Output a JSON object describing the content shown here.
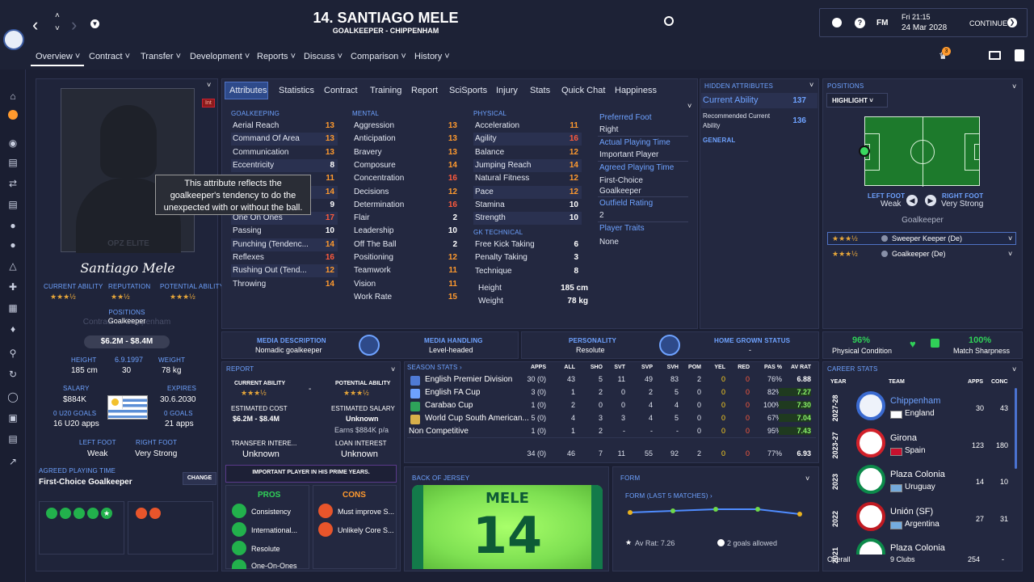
{
  "header": {
    "title": "14. SANTIAGO MELE",
    "subtitle": "GOALKEEPER - CHIPPENHAM",
    "date_line1": "Fri 21:15",
    "date_line2": "24 Mar 2028",
    "continue_label": "CONTINUE",
    "fm_label": "FM",
    "notif_count": "3"
  },
  "nav": [
    "Overview",
    "Contract",
    "Transfer",
    "Development",
    "Reports",
    "Discuss",
    "Comparison",
    "History"
  ],
  "tabs": [
    "Attributes",
    "Statistics",
    "Contract",
    "Training",
    "Report",
    "SciSports",
    "Injury",
    "Stats",
    "Quick Chat",
    "Happiness"
  ],
  "profile": {
    "int_badge": "Int",
    "photo_watermark": "OPZ ELITE",
    "signature": "Santiago Mele",
    "current_ability_label": "CURRENT ABILITY",
    "reputation_label": "REPUTATION",
    "potential_ability_label": "POTENTIAL ABILITY",
    "current_stars": "★★★½",
    "reputation_stars": "★★½",
    "potential_stars": "★★★½",
    "positions_label": "POSITIONS",
    "position_value": "Goalkeeper",
    "position_ghost": "Contract ... Chippenham",
    "value": "$6.2M - $8.4M",
    "height_label": "HEIGHT",
    "height": "185 cm",
    "dob": "6.9.1997",
    "age": "30",
    "weight_label": "WEIGHT",
    "weight": "78 kg",
    "salary_label": "SALARY",
    "salary": "$884K",
    "expires_label": "EXPIRES",
    "expires": "30.6.2030",
    "u20_goals": "0 U20 GOALS",
    "u20_apps": "16 U20 apps",
    "goals": "0 GOALS",
    "apps": "21 apps",
    "left_foot_label": "LEFT FOOT",
    "left_foot": "Weak",
    "right_foot_label": "RIGHT FOOT",
    "right_foot": "Very Strong",
    "agreed_label": "AGREED PLAYING TIME",
    "agreed_value": "First-Choice Goalkeeper",
    "change_label": "CHANGE"
  },
  "attributes": {
    "goalkeeping_label": "GOALKEEPING",
    "goalkeeping": [
      {
        "name": "Aerial Reach",
        "value": "13"
      },
      {
        "name": "Command Of Area",
        "value": "13"
      },
      {
        "name": "Communication",
        "value": "13"
      },
      {
        "name": "Eccentricity",
        "value": "8"
      },
      {
        "name": "",
        "value": "11"
      },
      {
        "name": "",
        "value": "14"
      },
      {
        "name": "",
        "value": "9"
      },
      {
        "name": "One On Ones",
        "value": "17"
      },
      {
        "name": "Passing",
        "value": "10"
      },
      {
        "name": "Punching (Tendenc...",
        "value": "14"
      },
      {
        "name": "Reflexes",
        "value": "16"
      },
      {
        "name": "Rushing Out (Tend...",
        "value": "12"
      },
      {
        "name": "Throwing",
        "value": "14"
      }
    ],
    "mental_label": "MENTAL",
    "mental": [
      {
        "name": "Aggression",
        "value": "13"
      },
      {
        "name": "Anticipation",
        "value": "13"
      },
      {
        "name": "Bravery",
        "value": "13"
      },
      {
        "name": "Composure",
        "value": "14"
      },
      {
        "name": "Concentration",
        "value": "16"
      },
      {
        "name": "Decisions",
        "value": "12"
      },
      {
        "name": "Determination",
        "value": "16"
      },
      {
        "name": "Flair",
        "value": "2"
      },
      {
        "name": "Leadership",
        "value": "10"
      },
      {
        "name": "Off The Ball",
        "value": "2"
      },
      {
        "name": "Positioning",
        "value": "12"
      },
      {
        "name": "Teamwork",
        "value": "11"
      },
      {
        "name": "Vision",
        "value": "11"
      },
      {
        "name": "Work Rate",
        "value": "15"
      }
    ],
    "physical_label": "PHYSICAL",
    "physical": [
      {
        "name": "Acceleration",
        "value": "11"
      },
      {
        "name": "Agility",
        "value": "16"
      },
      {
        "name": "Balance",
        "value": "12"
      },
      {
        "name": "Jumping Reach",
        "value": "14"
      },
      {
        "name": "Natural Fitness",
        "value": "12"
      },
      {
        "name": "Pace",
        "value": "12"
      },
      {
        "name": "Stamina",
        "value": "10"
      },
      {
        "name": "Strength",
        "value": "10"
      }
    ],
    "gk_technical_label": "GK TECHNICAL",
    "gk_technical": [
      {
        "name": "Free Kick Taking",
        "value": "6"
      },
      {
        "name": "Penalty Taking",
        "value": "3"
      },
      {
        "name": "Technique",
        "value": "8"
      }
    ],
    "height_label": "Height",
    "height": "185 cm",
    "weight_label": "Weight",
    "weight": "78 kg",
    "tooltip": "This attribute reflects the goalkeeper's tendency to do the unexpected with or without the ball."
  },
  "info_col": {
    "preferred_foot_label": "Preferred Foot",
    "preferred_foot": "Right",
    "actual_time_label": "Actual Playing Time",
    "actual_time": "Important Player",
    "agreed_time_label": "Agreed Playing Time",
    "agreed_time": "First-Choice Goalkeeper",
    "outfield_label": "Outfield Rating",
    "outfield": "2",
    "traits_label": "Player Traits",
    "traits": "None"
  },
  "hidden": {
    "title": "HIDDEN ATTRIBUTES",
    "current_ability_label": "Current Ability",
    "current_ability": "137",
    "recommended_label": "Recommended Current Ability",
    "recommended": "136",
    "general_label": "GENERAL"
  },
  "positions": {
    "title": "POSITIONS",
    "highlight_label": "HIGHLIGHT",
    "left_foot_label": "LEFT FOOT",
    "left_foot": "Weak",
    "right_foot_label": "RIGHT FOOT",
    "right_foot": "Very Strong",
    "position": "Goalkeeper",
    "roles": [
      {
        "stars": "★★★½",
        "name": "Sweeper Keeper (De)"
      },
      {
        "stars": "★★★½",
        "name": "Goalkeeper (De)"
      }
    ]
  },
  "media": {
    "desc_label": "MEDIA DESCRIPTION",
    "desc": "Nomadic goalkeeper",
    "handling_label": "MEDIA HANDLING",
    "handling": "Level-headed",
    "personality_label": "PERSONALITY",
    "personality": "Resolute",
    "homegrown_label": "HOME GROWN STATUS",
    "homegrown": "-"
  },
  "condition": {
    "physical": "96%",
    "physical_label": "Physical Condition",
    "sharpness": "100%",
    "sharpness_label": "Match Sharpness"
  },
  "report": {
    "title": "REPORT",
    "current_ability_label": "CURRENT ABILITY",
    "potential_ability_label": "POTENTIAL ABILITY",
    "current_stars": "★★★½",
    "potential_stars": "★★★½",
    "dash": "-",
    "est_cost_label": "ESTIMATED COST",
    "est_cost": "$6.2M - $8.4M",
    "est_salary_label": "ESTIMATED SALARY",
    "est_salary": "Unknown",
    "earns": "Earns $884K p/a",
    "transfer_interest_label": "TRANSFER INTERE...",
    "transfer_interest": "Unknown",
    "loan_interest_label": "LOAN INTEREST",
    "loan_interest": "Unknown",
    "important": "IMPORTANT PLAYER IN HIS PRIME YEARS.",
    "pros_label": "PROS",
    "cons_label": "CONS",
    "pros": [
      "Consistency",
      "International...",
      "Resolute",
      "One-On-Ones"
    ],
    "cons": [
      "Must improve S...",
      "Unlikely Core S..."
    ]
  },
  "season_stats": {
    "title": "SEASON STATS",
    "columns": [
      "APPS",
      "ALL",
      "SHO",
      "SVT",
      "SVP",
      "SVH",
      "POM",
      "YEL",
      "RED",
      "PAS %",
      "AV RAT"
    ],
    "rows": [
      {
        "comp": "English Premier Division",
        "vals": [
          "30 (0)",
          "43",
          "5",
          "11",
          "49",
          "83",
          "2",
          "0",
          "0",
          "76%",
          "6.88"
        ]
      },
      {
        "comp": "English FA Cup",
        "vals": [
          "3 (0)",
          "1",
          "2",
          "0",
          "2",
          "5",
          "0",
          "0",
          "0",
          "82%",
          "7.27"
        ]
      },
      {
        "comp": "Carabao Cup",
        "vals": [
          "1 (0)",
          "2",
          "0",
          "0",
          "4",
          "4",
          "0",
          "0",
          "0",
          "100%",
          "7.30"
        ]
      },
      {
        "comp": "World Cup South American...",
        "vals": [
          "5 (0)",
          "4",
          "3",
          "3",
          "4",
          "5",
          "0",
          "0",
          "0",
          "67%",
          "7.04"
        ]
      },
      {
        "comp": "Non Competitive",
        "vals": [
          "1 (0)",
          "1",
          "2",
          "-",
          "-",
          "-",
          "0",
          "0",
          "0",
          "95%",
          "7.43"
        ]
      }
    ],
    "total": [
      "34 (0)",
      "46",
      "7",
      "11",
      "55",
      "92",
      "2",
      "0",
      "0",
      "77%",
      "6.93"
    ]
  },
  "jersey": {
    "title": "BACK OF JERSEY",
    "name": "MELE",
    "number": "14"
  },
  "form": {
    "title": "FORM",
    "subtitle": "FORM (LAST 5 MATCHES)",
    "av_rat": "Av Rat: 7.26",
    "goals_allowed": "2 goals allowed"
  },
  "career": {
    "title": "CAREER STATS",
    "year_label": "YEAR",
    "team_label": "TEAM",
    "apps_label": "APPS",
    "conc_label": "CONC",
    "rows": [
      {
        "year": "2027-28",
        "team": "Chippenham",
        "nation": "England",
        "apps": "30",
        "conc": "43"
      },
      {
        "year": "2023-27",
        "team": "Girona",
        "nation": "Spain",
        "apps": "123",
        "conc": "180"
      },
      {
        "year": "2023",
        "team": "Plaza Colonia",
        "nation": "Uruguay",
        "apps": "14",
        "conc": "10"
      },
      {
        "year": "2022",
        "team": "Unión (SF)",
        "nation": "Argentina",
        "apps": "27",
        "conc": "31"
      },
      {
        "year": "2021",
        "team": "Plaza Colonia",
        "nation": "",
        "apps": "",
        "conc": ""
      }
    ],
    "overall_label": "Overall",
    "overall_clubs": "9 Clubs",
    "overall_apps": "254",
    "overall_conc": "-"
  },
  "colors": {
    "background": "#1b1f33",
    "panel": "#232840",
    "accent": "#6ea2ff",
    "high": "#ff9a2e",
    "pitch": "#1d7a2c"
  }
}
